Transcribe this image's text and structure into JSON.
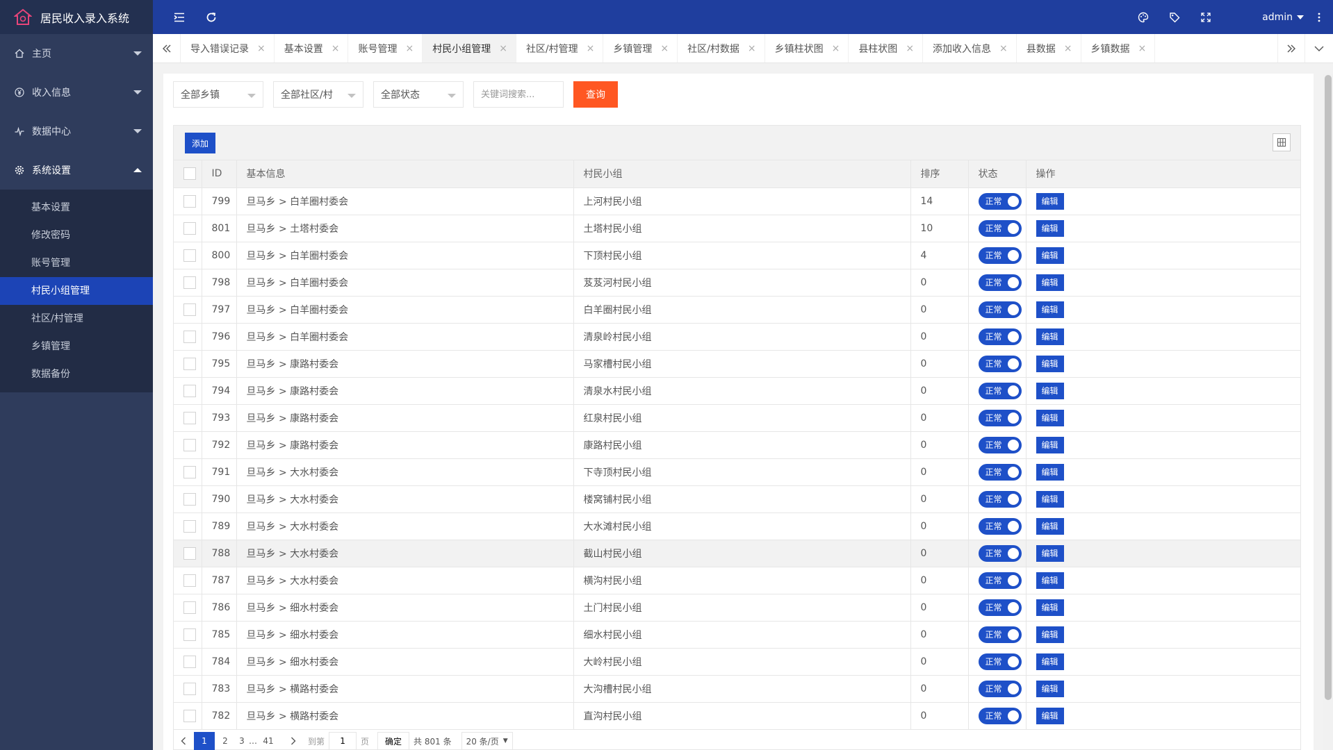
{
  "app": {
    "title": "居民收入录入系统"
  },
  "header": {
    "user": "admin"
  },
  "sidebar": {
    "groups": [
      {
        "label": "主页",
        "icon": "home-icon"
      },
      {
        "label": "收入信息",
        "icon": "yen-icon"
      },
      {
        "label": "数据中心",
        "icon": "pulse-icon"
      },
      {
        "label": "系统设置",
        "icon": "gear-icon"
      }
    ],
    "sub_items": [
      "基本设置",
      "修改密码",
      "账号管理",
      "村民小组管理",
      "社区/村管理",
      "乡镇管理",
      "数据备份"
    ],
    "active_sub": "村民小组管理"
  },
  "tabs": [
    "导入错误记录",
    "基本设置",
    "账号管理",
    "村民小组管理",
    "社区/村管理",
    "乡镇管理",
    "社区/村数据",
    "乡镇柱状图",
    "县柱状图",
    "添加收入信息",
    "县数据",
    "乡镇数据"
  ],
  "active_tab": "村民小组管理",
  "filters": {
    "town": "全部乡镇",
    "village": "全部社区/村",
    "status": "全部状态",
    "search_placeholder": "关键词搜索...",
    "query_label": "查询"
  },
  "toolbar": {
    "add_label": "添加"
  },
  "table": {
    "headers": {
      "id": "ID",
      "info": "基本信息",
      "group": "村民小组",
      "sort": "排序",
      "status": "状态",
      "action": "操作"
    },
    "status_label": "正常",
    "edit_label": "编辑",
    "rows": [
      {
        "id": "799",
        "info": "旦马乡 > 白羊圈村委会",
        "group": "上河村民小组",
        "sort": "14"
      },
      {
        "id": "801",
        "info": "旦马乡 > 土塔村委会",
        "group": "土塔村民小组",
        "sort": "10"
      },
      {
        "id": "800",
        "info": "旦马乡 > 白羊圈村委会",
        "group": "下顶村民小组",
        "sort": "4"
      },
      {
        "id": "798",
        "info": "旦马乡 > 白羊圈村委会",
        "group": "芨芨河村民小组",
        "sort": "0"
      },
      {
        "id": "797",
        "info": "旦马乡 > 白羊圈村委会",
        "group": "白羊圈村民小组",
        "sort": "0"
      },
      {
        "id": "796",
        "info": "旦马乡 > 白羊圈村委会",
        "group": "清泉岭村民小组",
        "sort": "0"
      },
      {
        "id": "795",
        "info": "旦马乡 > 康路村委会",
        "group": "马家槽村民小组",
        "sort": "0"
      },
      {
        "id": "794",
        "info": "旦马乡 > 康路村委会",
        "group": "清泉水村民小组",
        "sort": "0"
      },
      {
        "id": "793",
        "info": "旦马乡 > 康路村委会",
        "group": "红泉村民小组",
        "sort": "0"
      },
      {
        "id": "792",
        "info": "旦马乡 > 康路村委会",
        "group": "康路村民小组",
        "sort": "0"
      },
      {
        "id": "791",
        "info": "旦马乡 > 大水村委会",
        "group": "下寺顶村民小组",
        "sort": "0"
      },
      {
        "id": "790",
        "info": "旦马乡 > 大水村委会",
        "group": "楼窝铺村民小组",
        "sort": "0"
      },
      {
        "id": "789",
        "info": "旦马乡 > 大水村委会",
        "group": "大水滩村民小组",
        "sort": "0"
      },
      {
        "id": "788",
        "info": "旦马乡 > 大水村委会",
        "group": "截山村民小组",
        "sort": "0"
      },
      {
        "id": "787",
        "info": "旦马乡 > 大水村委会",
        "group": "横沟村民小组",
        "sort": "0"
      },
      {
        "id": "786",
        "info": "旦马乡 > 细水村委会",
        "group": "土门村民小组",
        "sort": "0"
      },
      {
        "id": "785",
        "info": "旦马乡 > 细水村委会",
        "group": "细水村民小组",
        "sort": "0"
      },
      {
        "id": "784",
        "info": "旦马乡 > 细水村委会",
        "group": "大岭村民小组",
        "sort": "0"
      },
      {
        "id": "783",
        "info": "旦马乡 > 横路村委会",
        "group": "大沟槽村民小组",
        "sort": "0"
      },
      {
        "id": "782",
        "info": "旦马乡 > 横路村委会",
        "group": "直沟村民小组",
        "sort": "0"
      }
    ]
  },
  "pagination": {
    "pages": [
      "1",
      "2",
      "3"
    ],
    "ellipsis": "…",
    "last_page": "41",
    "goto_prefix": "到第",
    "goto_value": "1",
    "goto_suffix": "页",
    "confirm": "确定",
    "total": "共 801 条",
    "per_page": "20 条/页"
  },
  "colors": {
    "header": "#1f3e9e",
    "sidebar": "#2f3c5c",
    "accent": "#1e50c8",
    "query": "#ff5722"
  }
}
